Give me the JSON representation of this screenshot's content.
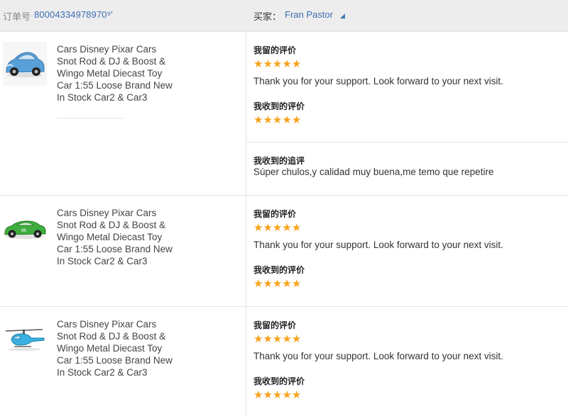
{
  "header": {
    "order_label": "订单号",
    "order_number": "80004334978970⁹'",
    "buyer_label": "买家：",
    "buyer_name": "Fran Pastor",
    "buyer_flag": "◢"
  },
  "items": [
    {
      "title": [
        "Cars Disney Pixar Cars",
        "Snot Rod & DJ & Boost &",
        "Wingo Metal Diecast Toy",
        "Car 1:55 Loose Brand New",
        "In Stock Car2 & Car3"
      ],
      "thumbnail_icon": "blue-car-toy-icon",
      "left_review_label": "我留的评价",
      "left_rating": 5,
      "left_comment": "Thank you for your support. Look forward to your next visit.",
      "received_review_label": "我收到的评价",
      "received_rating": 5,
      "followup_label": "我收到的追评",
      "followup_comment": "Súper chulos,y calidad muy buena,me temo que repetire"
    },
    {
      "title": [
        "Cars Disney Pixar Cars",
        "Snot Rod & DJ & Boost &",
        "Wingo Metal Diecast Toy",
        "Car 1:55 Loose Brand New",
        "In Stock Car2 & Car3"
      ],
      "thumbnail_icon": "green-race-car-icon",
      "left_review_label": "我留的评价",
      "left_rating": 5,
      "left_comment": "Thank you for your support. Look forward to your next visit.",
      "received_review_label": "我收到的评价",
      "received_rating": 5
    },
    {
      "title": [
        "Cars Disney Pixar Cars",
        "Snot Rod & DJ & Boost &",
        "Wingo Metal Diecast Toy",
        "Car 1:55 Loose Brand New",
        "In Stock Car2 & Car3"
      ],
      "thumbnail_icon": "helicopter-toy-icon",
      "left_review_label": "我留的评价",
      "left_rating": 5,
      "left_comment": "Thank you for your support. Look forward to your next visit.",
      "received_review_label": "我收到的评价",
      "received_rating": 5
    }
  ],
  "colors": {
    "link": "#3c6eb4",
    "star": "#f7a21b",
    "header_bg": "#ededed"
  }
}
